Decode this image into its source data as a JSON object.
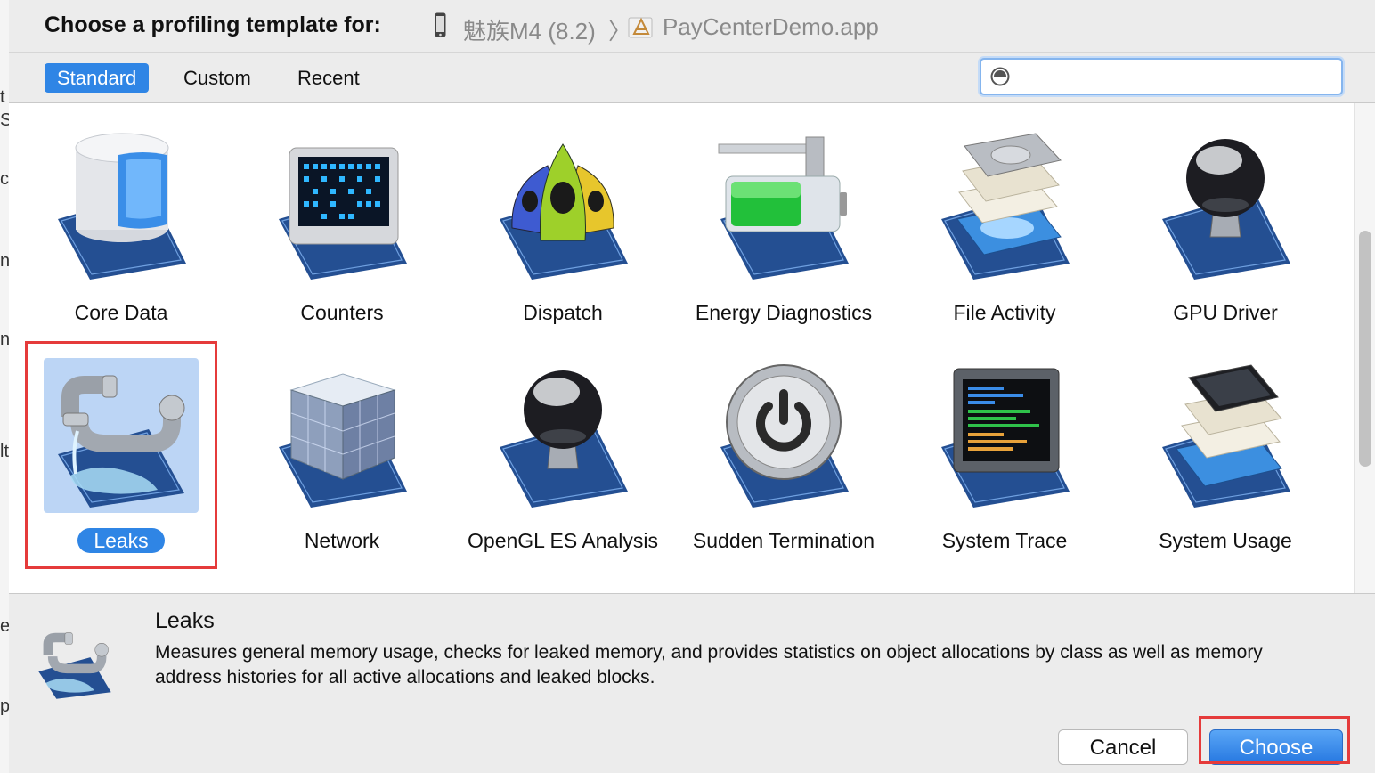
{
  "left_strip": {
    "fragments": [
      "t",
      "S",
      "c",
      "n",
      "n",
      "lt",
      "ex",
      "p"
    ]
  },
  "titlebar": {
    "label": "Choose a profiling template for:",
    "device": "魅族M4 (8.2)",
    "separator": "〉",
    "app": "PayCenterDemo.app"
  },
  "tabs": [
    {
      "label": "Standard",
      "active": true
    },
    {
      "label": "Custom",
      "active": false
    },
    {
      "label": "Recent",
      "active": false
    }
  ],
  "search": {
    "placeholder": "",
    "value": ""
  },
  "templates": [
    {
      "label": "Core Data",
      "icon": "core-data-icon"
    },
    {
      "label": "Counters",
      "icon": "counters-icon"
    },
    {
      "label": "Dispatch",
      "icon": "dispatch-icon"
    },
    {
      "label": "Energy Diagnostics",
      "icon": "energy-diagnostics-icon"
    },
    {
      "label": "File Activity",
      "icon": "file-activity-icon"
    },
    {
      "label": "GPU Driver",
      "icon": "gpu-driver-icon"
    },
    {
      "label": "Leaks",
      "icon": "leaks-icon",
      "selected": true
    },
    {
      "label": "Network",
      "icon": "network-icon"
    },
    {
      "label": "OpenGL ES Analysis",
      "icon": "opengl-es-analysis-icon"
    },
    {
      "label": "Sudden Termination",
      "icon": "sudden-termination-icon"
    },
    {
      "label": "System Trace",
      "icon": "system-trace-icon"
    },
    {
      "label": "System Usage",
      "icon": "system-usage-icon"
    }
  ],
  "info": {
    "title": "Leaks",
    "description": "Measures general memory usage, checks for leaked memory, and provides statistics on object allocations by class as well as memory address histories for all active allocations and leaked blocks."
  },
  "buttons": {
    "cancel": "Cancel",
    "choose": "Choose"
  },
  "colors": {
    "accent": "#2f85e5",
    "highlight": "#e53b3b",
    "selection": "#bcd5f5"
  }
}
